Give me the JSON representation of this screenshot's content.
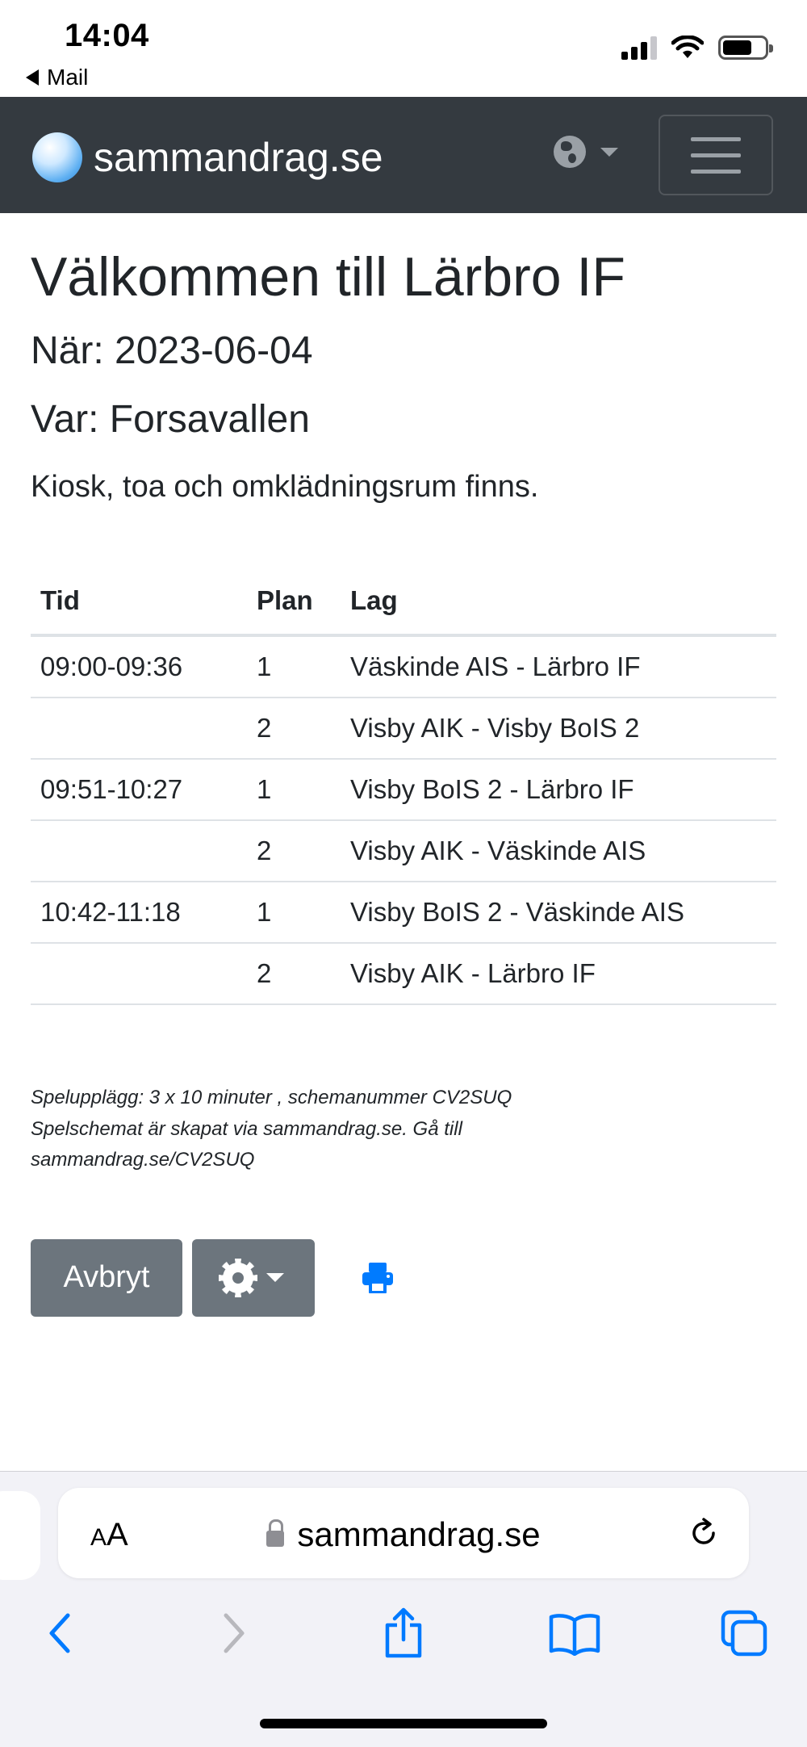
{
  "status_bar": {
    "time": "14:04",
    "back_app": "Mail"
  },
  "navbar": {
    "brand": "sammandrag.se",
    "icons": [
      "globe-icon",
      "chevron-down-icon",
      "hamburger-menu-icon"
    ]
  },
  "page": {
    "title": "Välkommen till Lärbro IF",
    "when": "När: 2023-06-04",
    "where": "Var: Forsavallen",
    "info": "Kiosk, toa och omklädningsrum finns."
  },
  "schedule": {
    "headers": [
      "Tid",
      "Plan",
      "Lag"
    ],
    "rows": [
      {
        "time": "09:00-09:36",
        "plan": "1",
        "match": "Väskinde AIS - Lärbro IF"
      },
      {
        "time": "",
        "plan": "2",
        "match": "Visby AIK - Visby BoIS 2"
      },
      {
        "time": "09:51-10:27",
        "plan": "1",
        "match": "Visby BoIS 2 - Lärbro IF"
      },
      {
        "time": "",
        "plan": "2",
        "match": "Visby AIK - Väskinde AIS"
      },
      {
        "time": "10:42-11:18",
        "plan": "1",
        "match": "Visby BoIS 2 - Väskinde AIS"
      },
      {
        "time": "",
        "plan": "2",
        "match": "Visby AIK - Lärbro IF"
      }
    ]
  },
  "footnote": {
    "line1": "Spelupplägg: 3 x 10 minuter , schemanummer CV2SUQ",
    "line2": "Spelschemat är skapat via sammandrag.se. Gå till",
    "line3": "sammandrag.se/CV2SUQ"
  },
  "actions": {
    "cancel_label": "Avbryt",
    "icons": [
      "gear-icon",
      "print-icon"
    ]
  },
  "browser": {
    "aa_small": "A",
    "aa_large": "A",
    "url": "sammandrag.se",
    "icons": [
      "back-icon",
      "forward-icon",
      "share-icon",
      "bookmarks-icon",
      "tabs-icon",
      "reload-icon",
      "lock-icon"
    ]
  },
  "colors": {
    "navbar_bg": "#343a40",
    "button_secondary": "#6c757d",
    "link_blue": "#007bff",
    "ios_blue": "#007aff"
  }
}
